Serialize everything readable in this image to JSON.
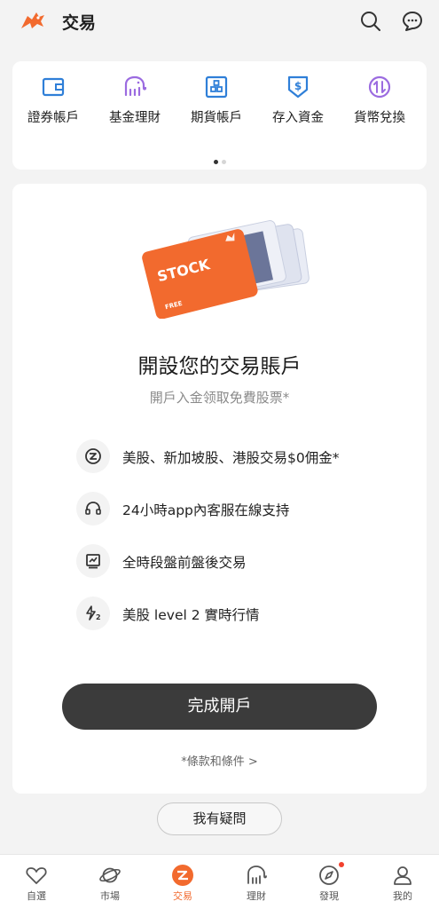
{
  "header": {
    "title": "交易",
    "logo_icon": "brand-bull-logo",
    "search_icon": "search-icon",
    "chat_icon": "chat-bubble-icon"
  },
  "quick_actions": [
    {
      "label": "證券帳戶",
      "icon": "wallet-icon"
    },
    {
      "label": "基金理財",
      "icon": "elephant-icon"
    },
    {
      "label": "期貨帳戶",
      "icon": "blocks-icon"
    },
    {
      "label": "存入資金",
      "icon": "deposit-icon"
    },
    {
      "label": "貨幣兌換",
      "icon": "exchange-icon"
    }
  ],
  "pager": {
    "current": 1,
    "total": 2
  },
  "open_account": {
    "illustration_text": "STOCK",
    "illustration_subtext": "FREE",
    "title": "開設您的交易賬戶",
    "subtitle": "開戶入金领取免費股票*",
    "features": [
      {
        "text": "美股、新加坡股、港股交易$0佣金*",
        "icon": "zero-commission-icon"
      },
      {
        "text": "24小時app內客服在線支持",
        "icon": "headset-icon"
      },
      {
        "text": "全時段盤前盤後交易",
        "icon": "chart-screen-icon"
      },
      {
        "text": "美股 level 2 實時行情",
        "icon": "lightning-level2-icon"
      }
    ],
    "cta_label": "完成開戶",
    "terms_label": "*條款和條件 >"
  },
  "faq_label": "我有疑問",
  "tabs": [
    {
      "label": "自選",
      "icon": "heart-icon"
    },
    {
      "label": "市場",
      "icon": "planet-icon"
    },
    {
      "label": "交易",
      "icon": "trade-icon",
      "active": true
    },
    {
      "label": "理財",
      "icon": "elephant-icon"
    },
    {
      "label": "發現",
      "icon": "compass-icon",
      "badge": true
    },
    {
      "label": "我的",
      "icon": "person-icon"
    }
  ],
  "colors": {
    "accent": "#f26a2e",
    "quick_action_icon": "#2f7fd8",
    "fund_icon": "#9b6be0",
    "cta_bg": "#3b3b3b",
    "page_bg": "#f3f3f3"
  }
}
